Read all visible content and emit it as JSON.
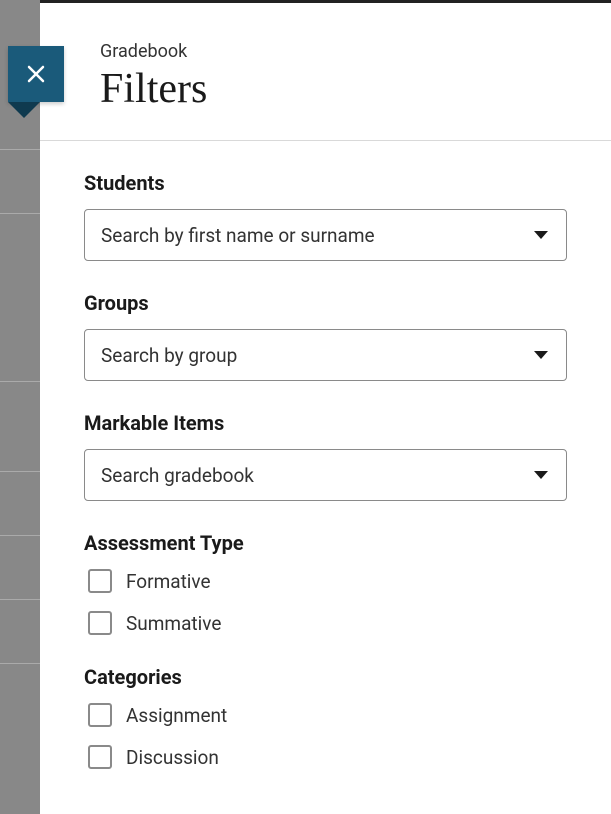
{
  "header": {
    "breadcrumb": "Gradebook",
    "title": "Filters"
  },
  "fields": {
    "students": {
      "label": "Students",
      "placeholder": "Search by first name or surname"
    },
    "groups": {
      "label": "Groups",
      "placeholder": "Search by group"
    },
    "markable_items": {
      "label": "Markable Items",
      "placeholder": "Search gradebook"
    },
    "assessment_type": {
      "label": "Assessment Type",
      "options": {
        "formative": "Formative",
        "summative": "Summative"
      }
    },
    "categories": {
      "label": "Categories",
      "options": {
        "assignment": "Assignment",
        "discussion": "Discussion"
      }
    }
  }
}
